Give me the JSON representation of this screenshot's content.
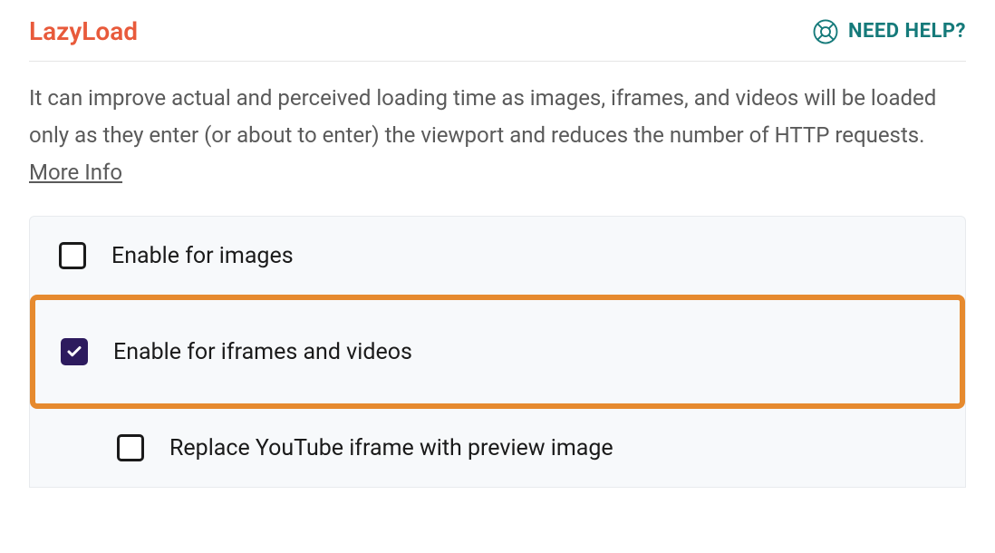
{
  "header": {
    "title": "LazyLoad",
    "help_label": "NEED HELP?",
    "help_icon": "lifebuoy-icon"
  },
  "description": {
    "text": "It can improve actual and perceived loading time as images, iframes, and videos will be loaded only as they enter (or about to enter) the viewport and reduces the number of HTTP requests. ",
    "more_info_label": "More Info"
  },
  "options": [
    {
      "id": "enable-images",
      "label": "Enable for images",
      "checked": false,
      "highlighted": false,
      "indented": false
    },
    {
      "id": "enable-iframes-videos",
      "label": "Enable for iframes and videos",
      "checked": true,
      "highlighted": true,
      "indented": false
    },
    {
      "id": "replace-youtube",
      "label": "Replace YouTube iframe with preview image",
      "checked": false,
      "highlighted": false,
      "indented": true
    }
  ],
  "colors": {
    "accent": "#e85a3b",
    "teal": "#157a7a",
    "highlight_border": "#e68a2e",
    "checkbox_checked_bg": "#2d1b5e"
  }
}
